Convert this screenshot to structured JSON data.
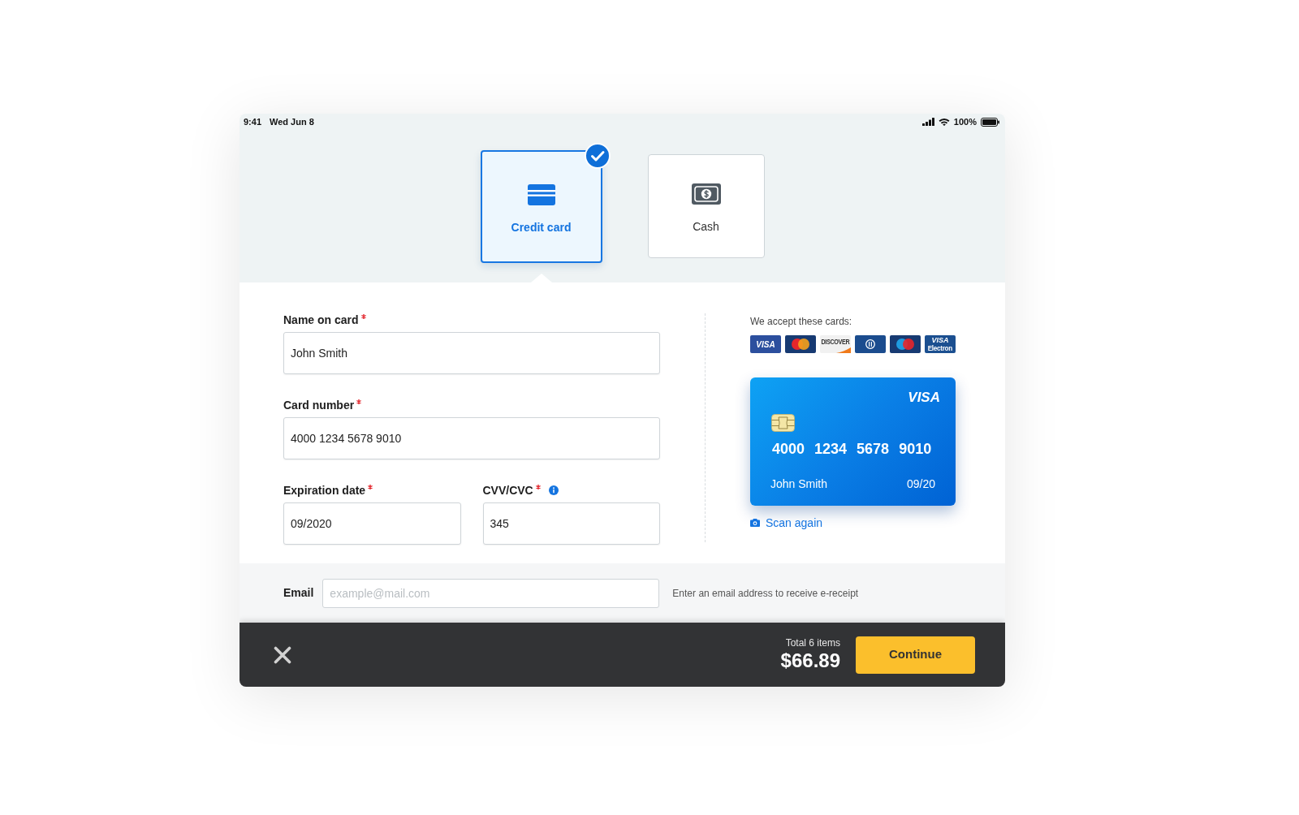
{
  "status_bar": {
    "time": "9:41",
    "date": "Wed Jun 8",
    "battery": "100%"
  },
  "payment_methods": [
    {
      "kind": "card",
      "label": "Credit card",
      "selected": true
    },
    {
      "kind": "cash",
      "label": "Cash",
      "selected": false
    }
  ],
  "card_form": {
    "fields": [
      {
        "label": "Name on card",
        "required": true,
        "info": false,
        "value": "John Smith"
      },
      {
        "label": "Card number",
        "required": true,
        "info": false,
        "value": "4000 1234 5678 9010"
      }
    ],
    "row_fields": [
      {
        "label": "Expiration date",
        "required": true,
        "info": false,
        "value": "09/2020"
      },
      {
        "label": "CVV/CVC",
        "required": true,
        "info": true,
        "value": "345"
      }
    ]
  },
  "accepted_cards": {
    "title": "We accept these cards:",
    "brands": [
      {
        "kind": "visa",
        "label": "VISA"
      },
      {
        "kind": "mastercard"
      },
      {
        "kind": "discover",
        "label": "DISCOVER"
      },
      {
        "kind": "diners"
      },
      {
        "kind": "maestro"
      },
      {
        "kind": "visa_electron",
        "label": "VISA",
        "sublabel": "Electron"
      }
    ]
  },
  "card_preview": {
    "brand": "VISA",
    "number": "4000 1234 5678 9010",
    "name": "John Smith",
    "expiry": "09/20"
  },
  "scan_link": {
    "label": "Scan again"
  },
  "email": {
    "label": "Email",
    "placeholder": "example@mail.com",
    "hint": "Enter an email address to receive e-receipt"
  },
  "footer": {
    "total_label": "Total 6 items",
    "total": "$66.89",
    "button": "Continue"
  }
}
